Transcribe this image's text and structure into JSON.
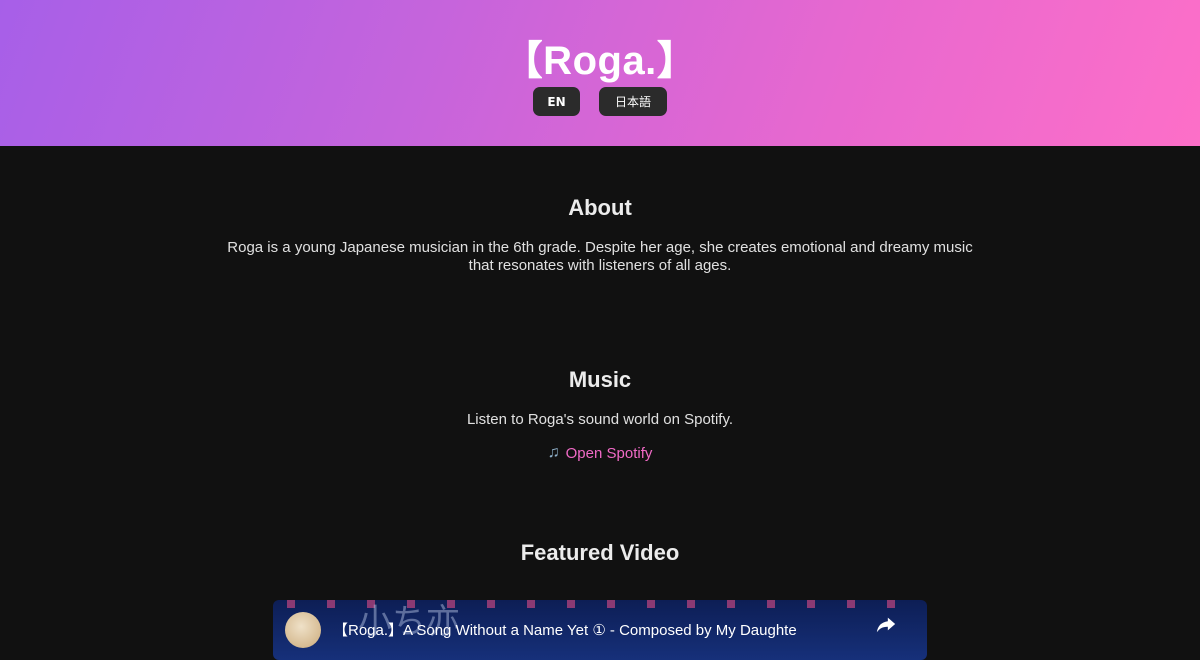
{
  "header": {
    "site_title": "【Roga.】",
    "lang_buttons": [
      "EN",
      "日本語"
    ]
  },
  "about": {
    "heading": "About",
    "text": "Roga is a young Japanese musician in the 6th grade. Despite her age, she creates emotional and dreamy music that resonates with listeners of all ages."
  },
  "music": {
    "heading": "Music",
    "text": "Listen to Roga's sound world on Spotify.",
    "link_label": "Open Spotify",
    "link_icon": "music-note-icon"
  },
  "featured_video": {
    "heading": "Featured Video",
    "video_title": "【Roga.】A Song Without a Name Yet ① - Composed by My Daughte",
    "background_text": "小ち亦"
  },
  "colors": {
    "header_gradient_start": "#a75fe8",
    "header_gradient_end": "#fd6fc8",
    "background": "#111111",
    "accent_link": "#f06ac6",
    "button_bg": "#2b2b2b"
  }
}
